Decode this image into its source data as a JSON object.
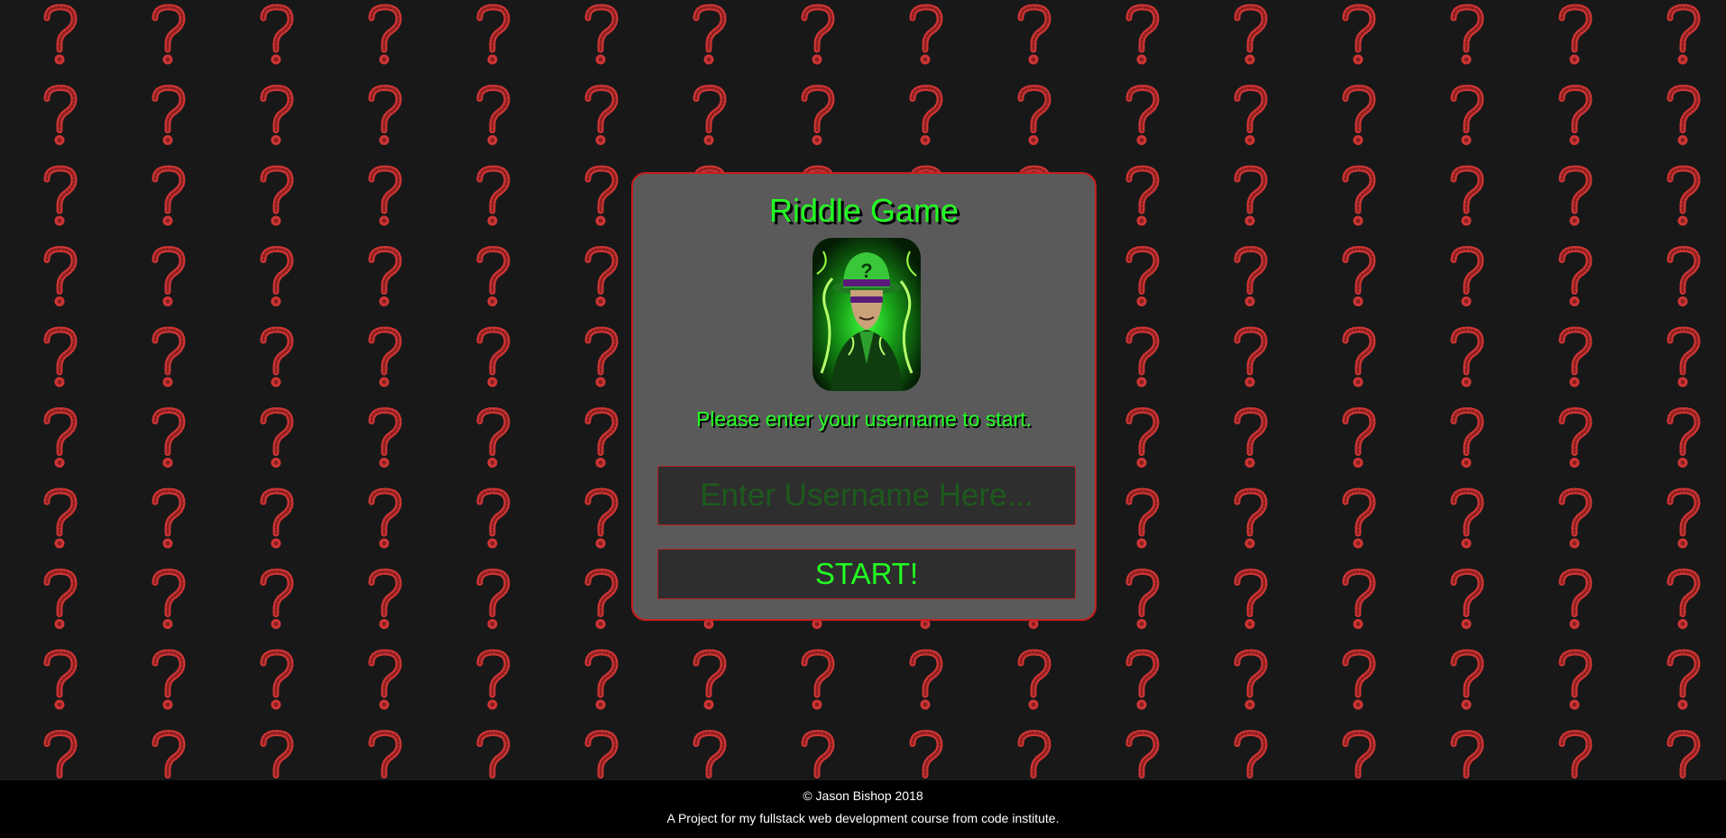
{
  "background": {
    "pattern_glyph": "?",
    "pattern_color": "#d83a3a",
    "base_color": "#181818"
  },
  "panel": {
    "title": "Riddle Game",
    "avatar_icon": "riddler-portrait",
    "prompt": "Please enter your username to start.",
    "username_placeholder": "Enter Username Here...",
    "username_value": "",
    "start_label": "START!",
    "accent_color": "#22ff22",
    "border_color": "#c81e1e"
  },
  "footer": {
    "copyright": "© Jason Bishop 2018",
    "note": "A Project for my fullstack web development course from code institute."
  }
}
